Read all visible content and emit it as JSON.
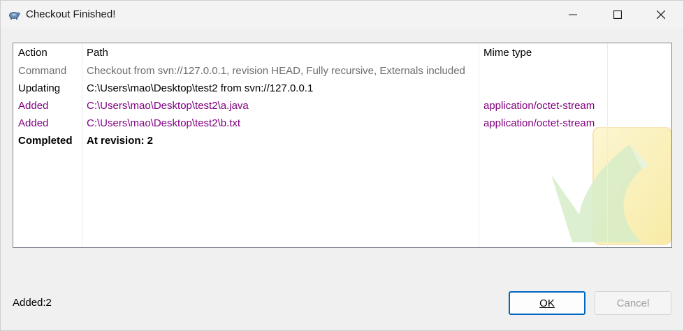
{
  "window": {
    "title": "Checkout Finished!",
    "controls": {
      "minimize_icon": "minimize-icon",
      "maximize_icon": "maximize-icon",
      "close_icon": "close-icon"
    }
  },
  "list": {
    "columns": [
      "Action",
      "Path",
      "Mime type"
    ],
    "rows": [
      {
        "action": "Command",
        "path": "Checkout from svn://127.0.0.1, revision HEAD, Fully recursive, Externals included",
        "mime": "",
        "style": "gray"
      },
      {
        "action": "Updating",
        "path": "C:\\Users\\mao\\Desktop\\test2 from svn://127.0.0.1",
        "mime": "",
        "style": "black"
      },
      {
        "action": "Added",
        "path": "C:\\Users\\mao\\Desktop\\test2\\a.java",
        "mime": "application/octet-stream",
        "style": "purple"
      },
      {
        "action": "Added",
        "path": "C:\\Users\\mao\\Desktop\\test2\\b.txt",
        "mime": "application/octet-stream",
        "style": "purple"
      },
      {
        "action": "Completed",
        "path": "At revision: 2",
        "mime": "",
        "style": "bold"
      }
    ]
  },
  "status": {
    "summary": "Added:2"
  },
  "buttons": {
    "ok": "OK",
    "cancel": "Cancel"
  },
  "colors": {
    "command": "#6d6d6d",
    "added": "#800080",
    "ok_border": "#0067c0"
  }
}
